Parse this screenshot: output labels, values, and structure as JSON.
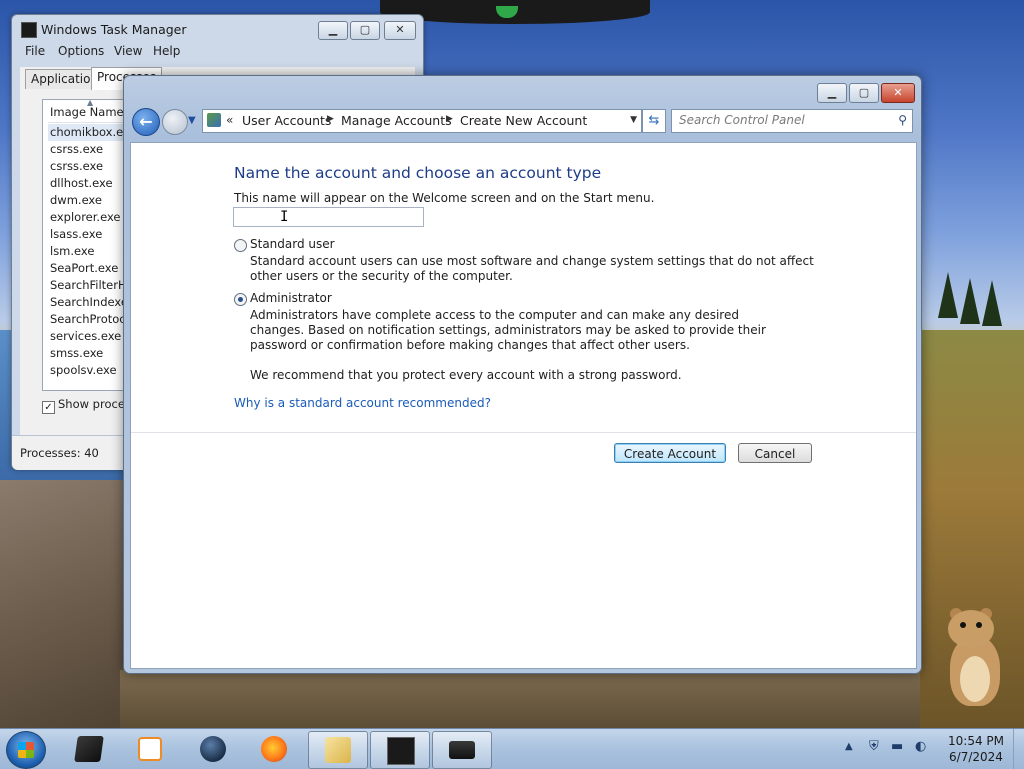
{
  "taskmgr": {
    "title": "Windows Task Manager",
    "menu": [
      "File",
      "Options",
      "View",
      "Help"
    ],
    "tabs": [
      "Applications",
      "Processes"
    ],
    "column": "Image Name",
    "processes": [
      "chomikbox.ex...",
      "csrss.exe",
      "csrss.exe",
      "dllhost.exe",
      "dwm.exe",
      "explorer.exe",
      "lsass.exe",
      "lsm.exe",
      "SeaPort.exe ...",
      "SearchFilterH...",
      "SearchIndexe...",
      "SearchProtoc...",
      "services.exe",
      "smss.exe",
      "spoolsv.exe"
    ],
    "show_processes_label": "Show process",
    "status": "Processes: 40"
  },
  "window": {
    "breadcrumb": [
      "User Accounts",
      "Manage Accounts",
      "Create New Account"
    ],
    "search_placeholder": "Search Control Panel"
  },
  "form": {
    "heading": "Name the account and choose an account type",
    "description": "This name will appear on the Welcome screen and on the Start menu.",
    "name_value": "",
    "options": [
      {
        "label": "Standard user",
        "description": "Standard account users can use most software and change system settings that do not affect other users or the security of the computer.",
        "selected": false
      },
      {
        "label": "Administrator",
        "description": "Administrators have complete access to the computer and can make any desired changes. Based on notification settings, administrators may be asked to provide their password or confirmation before making changes that affect other users.",
        "selected": true
      }
    ],
    "recommendation": "We recommend that you protect every account with a strong password.",
    "help_link": "Why is a standard account recommended?",
    "create_button": "Create Account",
    "cancel_button": "Cancel"
  },
  "taskbar": {
    "apps": [
      "terminal-icon",
      "media-player-icon",
      "globe-icon",
      "firefox-icon",
      "control-panel-icon",
      "task-manager-icon",
      "display-icon"
    ],
    "tray_icons": [
      "show-hidden-icons-icon",
      "security-shield-icon",
      "monitor-icon",
      "network-icon"
    ],
    "time": "10:54 PM",
    "date": "6/7/2024"
  },
  "colors": {
    "heading": "#1e3c87",
    "link": "#1a5bb8",
    "window_frame": "#a9bfdb",
    "close_button": "#c8452f"
  }
}
